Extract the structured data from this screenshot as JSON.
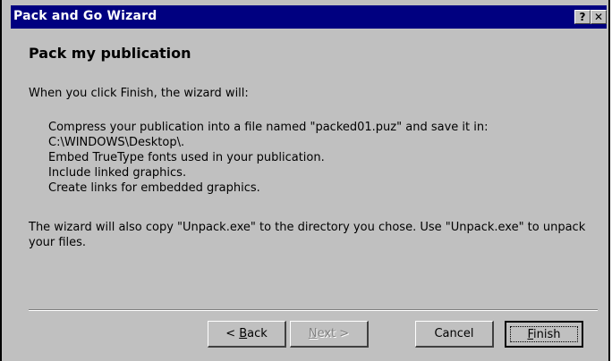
{
  "window": {
    "title": "Pack and Go Wizard",
    "help_label": "?",
    "close_label": "✕"
  },
  "page": {
    "heading": "Pack my publication",
    "intro": "When you click Finish, the wizard will:",
    "steps": [
      "Compress your publication into a file named \"packed01.puz\" and save it in:",
      "C:\\WINDOWS\\Desktop\\.",
      "Embed TrueType fonts used in your publication.",
      "Include linked graphics.",
      "Create links for embedded graphics."
    ],
    "note": "The wizard will also copy \"Unpack.exe\" to the directory you chose.  Use \"Unpack.exe\" to unpack your files."
  },
  "buttons": {
    "back": {
      "prefix": "< ",
      "mnemonic": "B",
      "rest": "ack"
    },
    "next": {
      "mnemonic": "N",
      "rest": "ext >"
    },
    "cancel": "Cancel",
    "finish": {
      "mnemonic": "F",
      "rest": "inish"
    }
  },
  "colors": {
    "titlebar": "#000080",
    "face": "#c0c0c0"
  }
}
